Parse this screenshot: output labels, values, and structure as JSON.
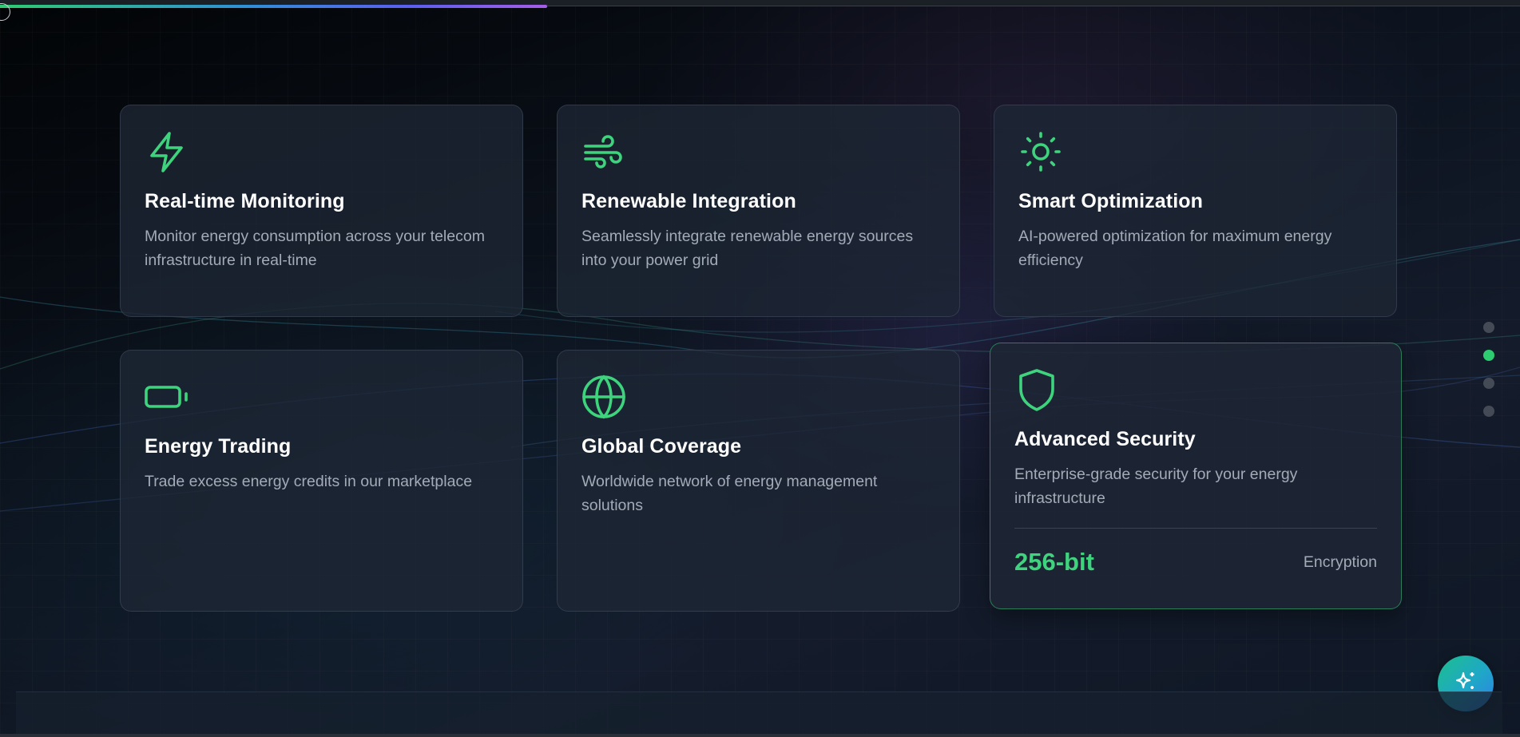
{
  "colors": {
    "accent_green": "#3ed47e",
    "card_bg": "#1e2634",
    "text_muted": "#a3abb8",
    "progress_gradient": [
      "#2ecc71",
      "#2f8fd8",
      "#a65de8"
    ]
  },
  "page_progress": 0.36,
  "features": [
    {
      "icon": "lightning-bolt-icon",
      "title": "Real-time Monitoring",
      "description": "Monitor energy consumption across your telecom infrastructure in real-time"
    },
    {
      "icon": "wind-icon",
      "title": "Renewable Integration",
      "description": "Seamlessly integrate renewable energy sources into your power grid"
    },
    {
      "icon": "sun-icon",
      "title": "Smart Optimization",
      "description": "AI-powered optimization for maximum energy efficiency"
    },
    {
      "icon": "battery-icon",
      "title": "Energy Trading",
      "description": "Trade excess energy credits in our marketplace"
    },
    {
      "icon": "globe-icon",
      "title": "Global Coverage",
      "description": "Worldwide network of energy management solutions"
    },
    {
      "icon": "shield-icon",
      "title": "Advanced Security",
      "description": "Enterprise-grade security for your energy infrastructure",
      "stat_value": "256-bit",
      "stat_label": "Encryption"
    }
  ],
  "section_nav": {
    "count": 4,
    "active_index": 1
  },
  "fab": {
    "icon": "sparkles-icon"
  }
}
